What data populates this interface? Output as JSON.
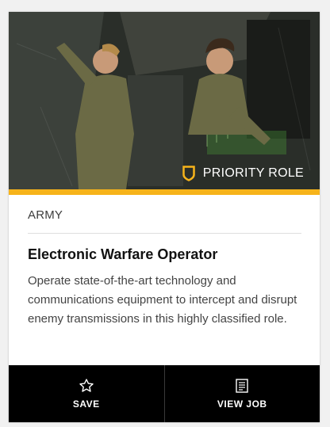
{
  "card": {
    "badge": {
      "label": "PRIORITY ROLE",
      "icon": "shield-badge-icon",
      "color": "#f6b31a"
    },
    "branch": "ARMY",
    "title": "Electronic Warfare Operator",
    "description": "Operate state-of-the-art technology and communications equipment to intercept and disrupt enemy transmissions in this highly classified role.",
    "actions": {
      "save": {
        "label": "SAVE",
        "icon": "star-outline-icon"
      },
      "view": {
        "label": "VIEW JOB",
        "icon": "document-icon"
      }
    }
  },
  "colors": {
    "accent": "#f6b31a",
    "action_bar": "#000000",
    "card_bg": "#ffffff"
  }
}
